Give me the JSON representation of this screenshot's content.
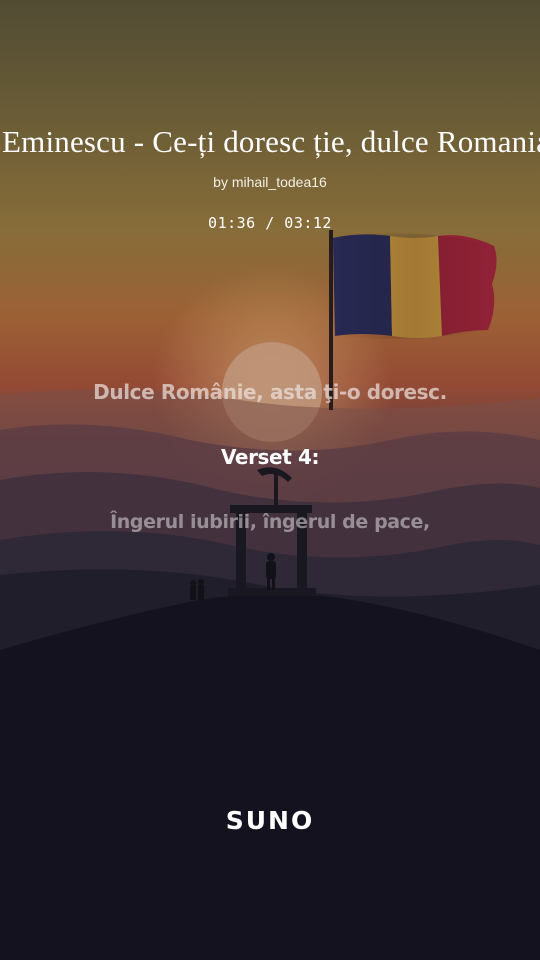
{
  "song": {
    "title": "Eminescu - Ce-ți doresc ție, dulce Romania",
    "artist_line": "by mihail_todea16",
    "time_display": "01:36 / 03:12",
    "current_seconds": 96,
    "total_seconds": 192
  },
  "lyrics": {
    "previous": "Dulce Românie, asta ţi-o doresc.",
    "current": "Verset 4:",
    "next": "Îngerul iubirii, îngerul de pace,"
  },
  "brand": {
    "logo_text": "SUNO"
  },
  "colors": {
    "sky_top": "#6e6238",
    "sky_mid": "#b26a36",
    "ground": "#0e0d1a",
    "flag_blue": "#2b2d5a",
    "flag_yellow": "#d09a3c",
    "flag_red": "#a02434"
  },
  "background_icons": [
    "romanian-flag-icon",
    "setting-sun-icon",
    "hill-monument-icon",
    "people-silhouette-icon"
  ]
}
